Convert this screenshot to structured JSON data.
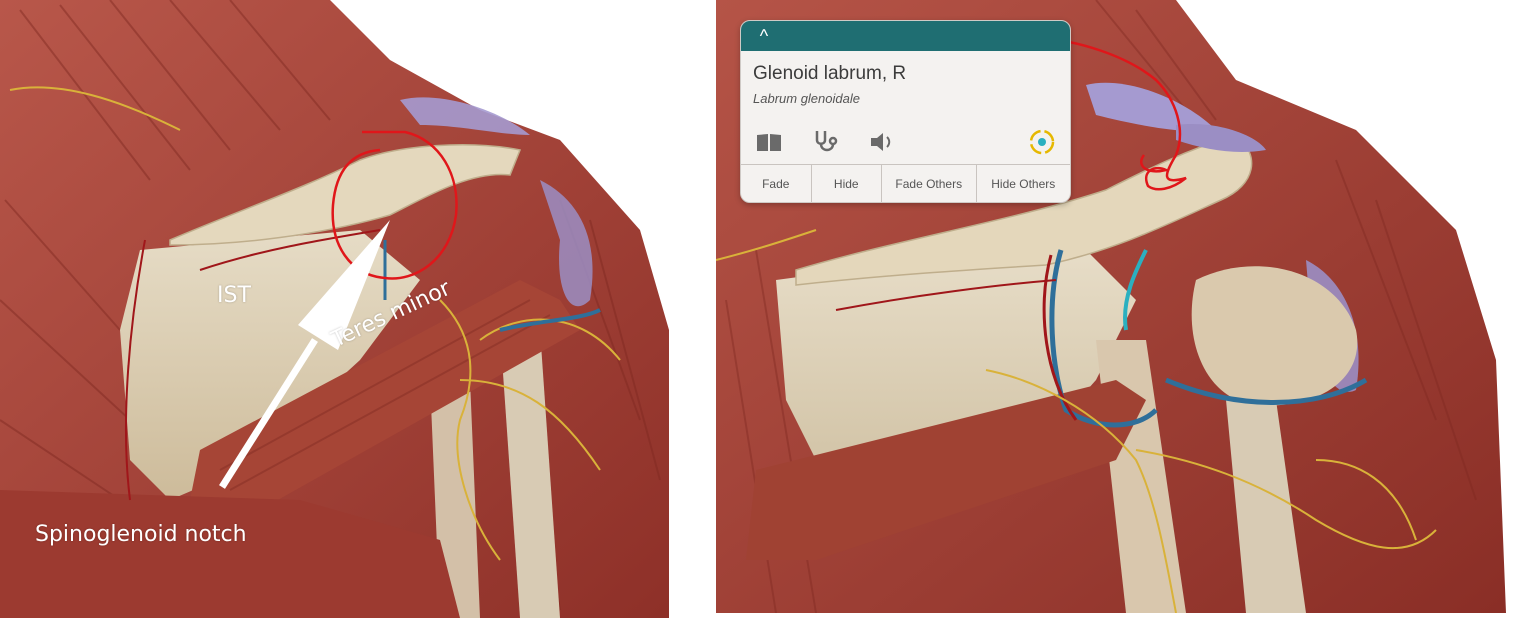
{
  "left_panel": {
    "labels": {
      "ist": "IST",
      "teres_minor": "Teres minor",
      "spinoglenoid_notch": "Spinoglenoid notch"
    }
  },
  "info_card": {
    "collapse_label": "^",
    "title": "Glenoid labrum, R",
    "subtitle": "Labrum glenoidale",
    "icons": [
      "book-icon",
      "stethoscope-icon",
      "speaker-icon",
      "isolate-icon"
    ],
    "actions": [
      "Fade",
      "Hide",
      "Fade Others",
      "Hide Others"
    ],
    "header_color": "#1f6e72",
    "accent_color": "#e6b800"
  },
  "colors": {
    "muscle": "#a9473e",
    "bone": "#d9c9ad",
    "ligament": "#9b8ec4",
    "nerve": "#d9b23a",
    "artery": "#a0161a",
    "vein": "#2f6f9a",
    "annotation": "#e0161a"
  }
}
